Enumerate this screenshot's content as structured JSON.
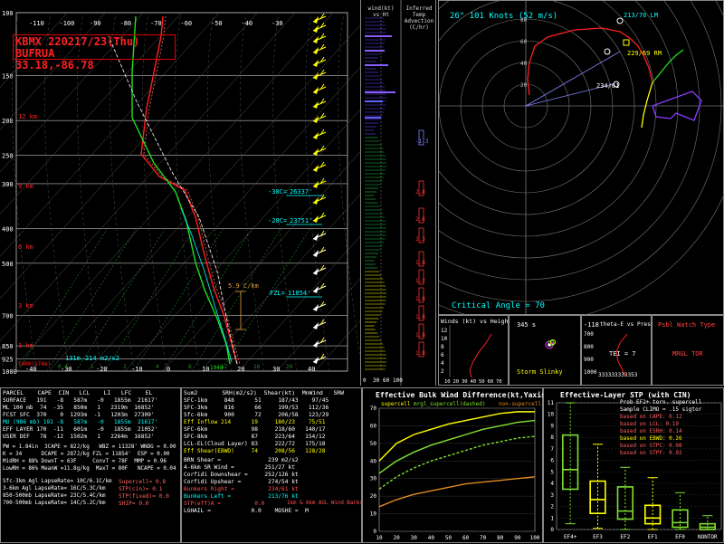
{
  "skewt": {
    "station_line1": "KBMX 220217/23(Thu) BUFRUA",
    "station_line2": "33.18,-86.78",
    "pressure_labels": [
      "100",
      "150",
      "200",
      "250",
      "300",
      "400",
      "500",
      "700",
      "850",
      "925",
      "1000"
    ],
    "temp_labels_top": [
      "-110",
      "-100",
      "-90",
      "-80",
      "-70",
      "-60",
      "-50",
      "-40",
      "-30"
    ],
    "temp_labels_bottom": [
      "-40",
      "-30",
      "-20",
      "-10",
      "0",
      "10",
      "20",
      "30",
      "40"
    ],
    "height_labels": [
      "12 km",
      "9 km",
      "6 km",
      "3 km",
      "1 km"
    ],
    "mixing_labels": [
      "0.4",
      "1",
      "2",
      "4",
      "8",
      "12",
      "16",
      "20"
    ],
    "isotherm_labels": [
      "-30C=",
      "26337'",
      "-20C=",
      "23751'",
      "FZL=",
      "11854'"
    ],
    "lapse_label": "5.9 C/km",
    "sfc_label1": "131m",
    "sfc_label2": "214 m2/s2",
    "bottom_left": "1000(174m)",
    "bottom_mid": "1948"
  },
  "wind_panel": {
    "title": "wind(kt)\nvs Ht",
    "axis": [
      "0",
      "30",
      "60",
      "100"
    ],
    "adv_title": "Inferred\nTemp\nAdvection\n(C/hr)",
    "adv_values": [
      "-1.3",
      "2.8",
      "2.6",
      "2.3",
      "1.8",
      "1.2",
      "1.8",
      "1.8",
      "1.8",
      "1.8"
    ]
  },
  "hodograph": {
    "header": "26° 101 Knots (52 m/s)",
    "rm_label": "213/76 LM",
    "lm_label": "229/69 RM",
    "sm_label": "234/61",
    "ring_labels": [
      "20",
      "40",
      "60",
      "80",
      "100",
      "120"
    ],
    "critical_angle": "Critical Angle = 70"
  },
  "small_panels": {
    "winds_title": "Winds (kt) vs Height",
    "winds_x": [
      "10",
      "20",
      "30",
      "40",
      "50",
      "60",
      "70"
    ],
    "winds_y": [
      "12",
      "10",
      "8",
      "6",
      "4",
      "2"
    ],
    "storm_slinky": "Storm Slinky",
    "slinky_angle": "345 s",
    "theta_title": "theta-E vs Pressure",
    "theta_value": "-118",
    "theta_y": [
      "700",
      "800",
      "900",
      "1000"
    ],
    "tei": "TEI = 7",
    "theta_x": "333333333353",
    "watch_title": "Psbl Watch Type",
    "watch_value": "MRGL TOR"
  },
  "parcel_table": {
    "header": "PARCEL    CAPE  CIN   LCL    LI   LFC    EL",
    "rows": [
      {
        "text": "SURFACE   191   -8   587m   -0   1855m  21617'",
        "color": "#ffffff"
      },
      {
        "text": "ML 100 mb  74  -35   850m   1   2319m  16852'",
        "color": "#ffffff"
      },
      {
        "text": "FCST SFC  370    0  1293m  -1   1203m  27309'",
        "color": "#ffffff"
      },
      {
        "text": "MU (986 mb) 191 -8   587m   -0   1855m  21617'",
        "color": "#00ffff"
      },
      {
        "text": "EFF LAYER 170  -11   601m   -0   1855m  21052'",
        "color": "#ffffff"
      },
      {
        "text": "USER DEF   78  -12  1502m   1   2264m  16852'",
        "color": "#ffffff"
      }
    ],
    "stats": [
      "PW = 1.84in  3CAPE = 82J/kg   WBZ = 11328' WNDG = 0.00",
      "K = 34      DCAPE = 287J/kg FZL = 11854'  ESP = 0.00",
      "MidRH = 88% DownT = 63F     ConvT = 78F  MMP = 0.96",
      "LowRH = 86% MeanW =11.8g/kg  MaxT = 80F   NCAPE = 0.04"
    ],
    "lapse": [
      "Sfc-3km Agl LapseRate= 10C/6.1C/km",
      "3-6km Agl LapseRate= 16C/5.3C/km",
      "850-500mb LapseRate= 23C/5.4C/km",
      "700-500mb LapseRate= 14C/5.2C/km"
    ],
    "indices": [
      {
        "label": "Supercell=",
        "value": "0.8"
      },
      {
        "label": "STP(cin)=",
        "value": "0.1"
      },
      {
        "label": "STP(fixed)=",
        "value": "0.0"
      },
      {
        "label": "SHIP=",
        "value": "0.0"
      }
    ]
  },
  "kinematic_table": {
    "header": "Sum2       SRH(m2/s2)  Shear(kt)  MnWind   SRW",
    "rows": [
      {
        "text": "SFC-1km     848      51     187/43    97/45",
        "color": "#ffffff"
      },
      {
        "text": "SFC-3km     816      66     199/53   112/36",
        "color": "#ffffff"
      },
      {
        "text": "Sfc-6km     900      72     206/58   123/29",
        "color": "#ffffff"
      },
      {
        "text": "Eff Inflow 214      19     180/23    75/51",
        "color": "#ffff00"
      },
      {
        "text": "SFC-6km             98     218/60   140/17",
        "color": "#ffffff"
      },
      {
        "text": "SFC-8km             87     223/64   154/12",
        "color": "#ffffff"
      },
      {
        "text": "LCL-EL(Cloud Layer) 83     222/72   175/18",
        "color": "#ffffff"
      },
      {
        "text": "Eff Shear(EBWD)     74     208/56   128/28",
        "color": "#ffff00"
      }
    ],
    "extra": [
      {
        "text": "BRN Shear =              239 m2/s2",
        "color": "#ffffff"
      },
      {
        "text": "4-6km SR Wind =         251/27 kt",
        "color": "#ffffff"
      },
      {
        "text": "Corfidi Downshear =     252/126 kt",
        "color": "#ffffff"
      },
      {
        "text": "Corfidi Upshear =        274/54 kt",
        "color": "#ffffff"
      },
      {
        "text": "Bunkers Right =          234/61 kt",
        "color": "#ff5050"
      },
      {
        "text": "Bunkers Left =           213/76 kt",
        "color": "#00ffff"
      },
      {
        "text": "STP(eff)A =          0.0",
        "color": "#ff5050"
      },
      {
        "text": "LGHAIL =            0.0    MOSHE =  M",
        "color": "#ffffff"
      }
    ],
    "windbar_label": "1km & 6km AGL Wind Barbs"
  },
  "ebwd": {
    "title": "Effective Bulk Wind Difference(kt,Yaxis)",
    "legend": [
      "supercell",
      "mrgl_supercell(dashed)",
      "non-supercell"
    ],
    "x_ticks": [
      "10",
      "20",
      "30",
      "40",
      "50",
      "60",
      "70",
      "80",
      "90",
      "100"
    ],
    "y_ticks": [
      "0",
      "10",
      "20",
      "30",
      "40",
      "50",
      "60",
      "70"
    ],
    "xlim": [
      10,
      100
    ],
    "ylim": [
      0,
      70
    ]
  },
  "stp": {
    "title": "Effective-Layer STP (with CIN)",
    "notes": [
      {
        "label": "Prob EF2+ torn. supercell",
        "value": ""
      },
      {
        "label": "Sample CLIMO = .15 sigtor",
        "value": ""
      },
      {
        "label": "based on CAPE:",
        "value": "0.12"
      },
      {
        "label": "based on LCL:",
        "value": "0.19"
      },
      {
        "label": "based on ESRH:",
        "value": "0.14"
      },
      {
        "label": "based on EBWD:",
        "value": "0.26"
      },
      {
        "label": "based on STPC:",
        "value": "0.08"
      },
      {
        "label": "based on STPF:",
        "value": "0.02"
      }
    ],
    "categories": [
      "EF4+",
      "EF3",
      "EF2",
      "EF1",
      "EF0",
      "NONTOR"
    ],
    "y_ticks": [
      "0",
      "1",
      "2",
      "3",
      "4",
      "5",
      "6",
      "7",
      "8",
      "9",
      "10",
      "11"
    ],
    "ylim": [
      0,
      11
    ]
  },
  "chart_data": [
    {
      "type": "line",
      "title": "Effective Bulk Wind Difference(kt,Yaxis)",
      "x": [
        10,
        20,
        30,
        40,
        50,
        60,
        70,
        80,
        90,
        100
      ],
      "ylim": [
        0,
        70
      ],
      "series": [
        {
          "name": "supercell",
          "values": [
            40,
            50,
            55,
            58,
            61,
            63,
            65,
            67,
            68,
            68
          ]
        },
        {
          "name": "mrgl_supercell(dashed)",
          "values": [
            24,
            31,
            36,
            40,
            43,
            46,
            49,
            51,
            53,
            54
          ]
        },
        {
          "name": "non-supercell",
          "values": [
            14,
            18,
            21,
            23,
            25,
            27,
            28,
            29,
            30,
            31
          ]
        }
      ]
    },
    {
      "type": "box",
      "title": "Effective-Layer STP (with CIN)",
      "categories": [
        "EF4+",
        "EF3",
        "EF2",
        "EF1",
        "EF0",
        "NONTOR"
      ],
      "ylim": [
        0,
        11
      ],
      "boxes": [
        {
          "whislo": 0.5,
          "q1": 3.5,
          "med": 5.2,
          "q3": 8.2,
          "whishi": 11.0
        },
        {
          "whislo": 0.1,
          "q1": 1.4,
          "med": 2.6,
          "q3": 4.2,
          "whishi": 7.4
        },
        {
          "whislo": 0.0,
          "q1": 0.9,
          "med": 1.6,
          "q3": 3.7,
          "whishi": 5.4
        },
        {
          "whislo": 0.0,
          "q1": 0.5,
          "med": 1.0,
          "q3": 2.1,
          "whishi": 4.5
        },
        {
          "whislo": 0.0,
          "q1": 0.2,
          "med": 0.6,
          "q3": 1.7,
          "whishi": 3.2
        },
        {
          "whislo": 0.0,
          "q1": 0.0,
          "med": 0.2,
          "q3": 0.5,
          "whishi": 1.2
        }
      ]
    }
  ]
}
